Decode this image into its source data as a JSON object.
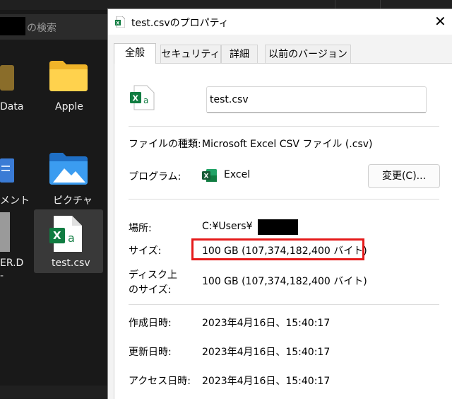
{
  "explorer": {
    "search_placeholder": "の検索",
    "items": [
      {
        "label": "Data",
        "kind": "folder-dark"
      },
      {
        "label": "Apple",
        "kind": "folder"
      },
      {
        "label": "メント",
        "kind": "documents-folder"
      },
      {
        "label": "ピクチャ",
        "kind": "pictures-folder"
      },
      {
        "label": "ER.D",
        "kind": "file"
      },
      {
        "label": "test.csv",
        "kind": "excel-csv"
      }
    ]
  },
  "dialog": {
    "title": "test.csvのプロパティ",
    "close_glyph": "✕",
    "tabs": [
      "全般",
      "セキュリティ",
      "詳細",
      "以前のバージョン"
    ],
    "active_tab": "全般",
    "file_name": "test.csv",
    "rows": {
      "file_type": {
        "label": "ファイルの種類:",
        "value": "Microsoft Excel CSV ファイル (.csv)"
      },
      "program": {
        "label": "プログラム:",
        "value": "Excel",
        "button": "変更(C)..."
      },
      "location": {
        "label": "場所:",
        "value": "C:¥Users¥"
      },
      "size": {
        "label": "サイズ:",
        "value": "100 GB (107,374,182,400 バイト)"
      },
      "size_on_disk": {
        "label_line1": "ディスク上",
        "label_line2": "のサイズ:",
        "value": "100 GB (107,374,182,400 バイト)"
      },
      "created": {
        "label": "作成日時:",
        "value": "2023年4月16日、15:40:17"
      },
      "modified": {
        "label": "更新日時:",
        "value": "2023年4月16日、15:40:17"
      },
      "accessed": {
        "label": "アクセス日時:",
        "value": "2023年4月16日、15:40:17"
      }
    },
    "highlight_color": "#e51a1a"
  },
  "colors": {
    "excel_green": "#107c41",
    "folder_yellow": "#f4c542",
    "pictures_blue": "#2f8ad9"
  }
}
